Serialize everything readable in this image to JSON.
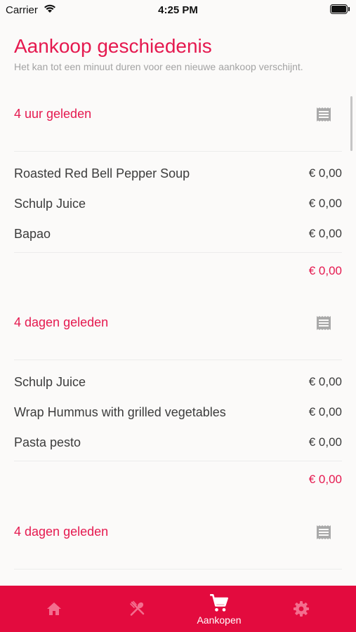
{
  "status_bar": {
    "carrier": "Carrier",
    "time": "4:25 PM"
  },
  "header": {
    "title": "Aankoop geschiedenis",
    "subtitle": "Het kan tot een minuut duren voor een nieuwe aankoop verschijnt."
  },
  "purchases": [
    {
      "date": "4 uur geleden",
      "items": [
        {
          "name": "Roasted Red Bell Pepper Soup",
          "price": "€ 0,00"
        },
        {
          "name": "Schulp Juice",
          "price": "€ 0,00"
        },
        {
          "name": "Bapao",
          "price": "€ 0,00"
        }
      ],
      "total": "€ 0,00"
    },
    {
      "date": "4 dagen geleden",
      "items": [
        {
          "name": "Schulp Juice",
          "price": "€ 0,00"
        },
        {
          "name": "Wrap Hummus with grilled vegetables",
          "price": "€ 0,00"
        },
        {
          "name": "Pasta pesto",
          "price": "€ 0,00"
        }
      ],
      "total": "€ 0,00"
    },
    {
      "date": "4 dagen geleden"
    }
  ],
  "tab_bar": {
    "tabs": [
      {
        "icon": "home-icon"
      },
      {
        "icon": "utensils-icon"
      },
      {
        "icon": "cart-icon",
        "label": "Aankopen",
        "active": true
      },
      {
        "icon": "gear-icon"
      }
    ]
  },
  "colors": {
    "accent": "#e5194f",
    "tab_bar": "#e30b3e",
    "background": "#fbfaf9"
  }
}
